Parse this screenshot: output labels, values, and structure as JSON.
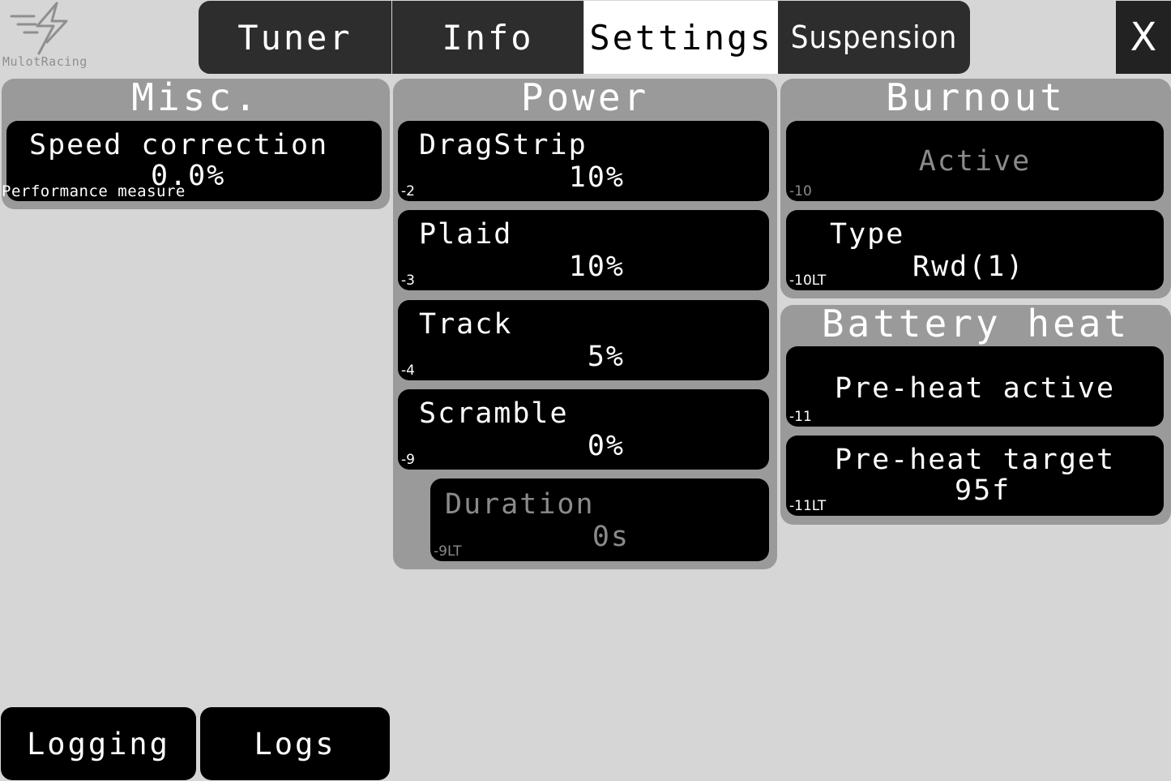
{
  "logo": {
    "text": "MulotRacing",
    "icon": "lightning-bolt-icon"
  },
  "tabs": [
    {
      "label": "Tuner",
      "active": false
    },
    {
      "label": "Info",
      "active": false
    },
    {
      "label": "Settings",
      "active": true
    },
    {
      "label": "Suspension",
      "active": false
    }
  ],
  "close_label": "X",
  "panels": {
    "misc": {
      "title": "Misc.",
      "speed": {
        "label": "Speed correction",
        "value": "0.0%",
        "note": "Performance measure"
      }
    },
    "power": {
      "title": "Power",
      "items": [
        {
          "label": "DragStrip",
          "value": "10%",
          "code": "-2"
        },
        {
          "label": "Plaid",
          "value": "10%",
          "code": "-3"
        },
        {
          "label": "Track",
          "value": "5%",
          "code": "-4"
        },
        {
          "label": "Scramble",
          "value": "0%",
          "code": "-9"
        }
      ],
      "duration": {
        "label": "Duration",
        "value": "0s",
        "code": "-9LT",
        "enabled": false
      }
    },
    "burnout": {
      "title": "Burnout",
      "active": {
        "label": "Active",
        "code": "-10",
        "enabled": false
      },
      "type": {
        "label": "Type",
        "value": "Rwd(1)",
        "code": "-10LT"
      }
    },
    "battery": {
      "title": "Battery heat",
      "preheat_active": {
        "label": "Pre-heat active",
        "code": "-11"
      },
      "preheat_target": {
        "label": "Pre-heat target",
        "value": "95f",
        "code": "-11LT"
      }
    }
  },
  "bottom": {
    "logging_label": "Logging",
    "logs_label": "Logs"
  },
  "colors": {
    "background": "#d6d6d6",
    "panel": "#9a9a9a",
    "tile": "#000000",
    "tab": "#2d2d2d",
    "active_tab": "#ffffff",
    "disabled_text": "#8a8a8a"
  }
}
